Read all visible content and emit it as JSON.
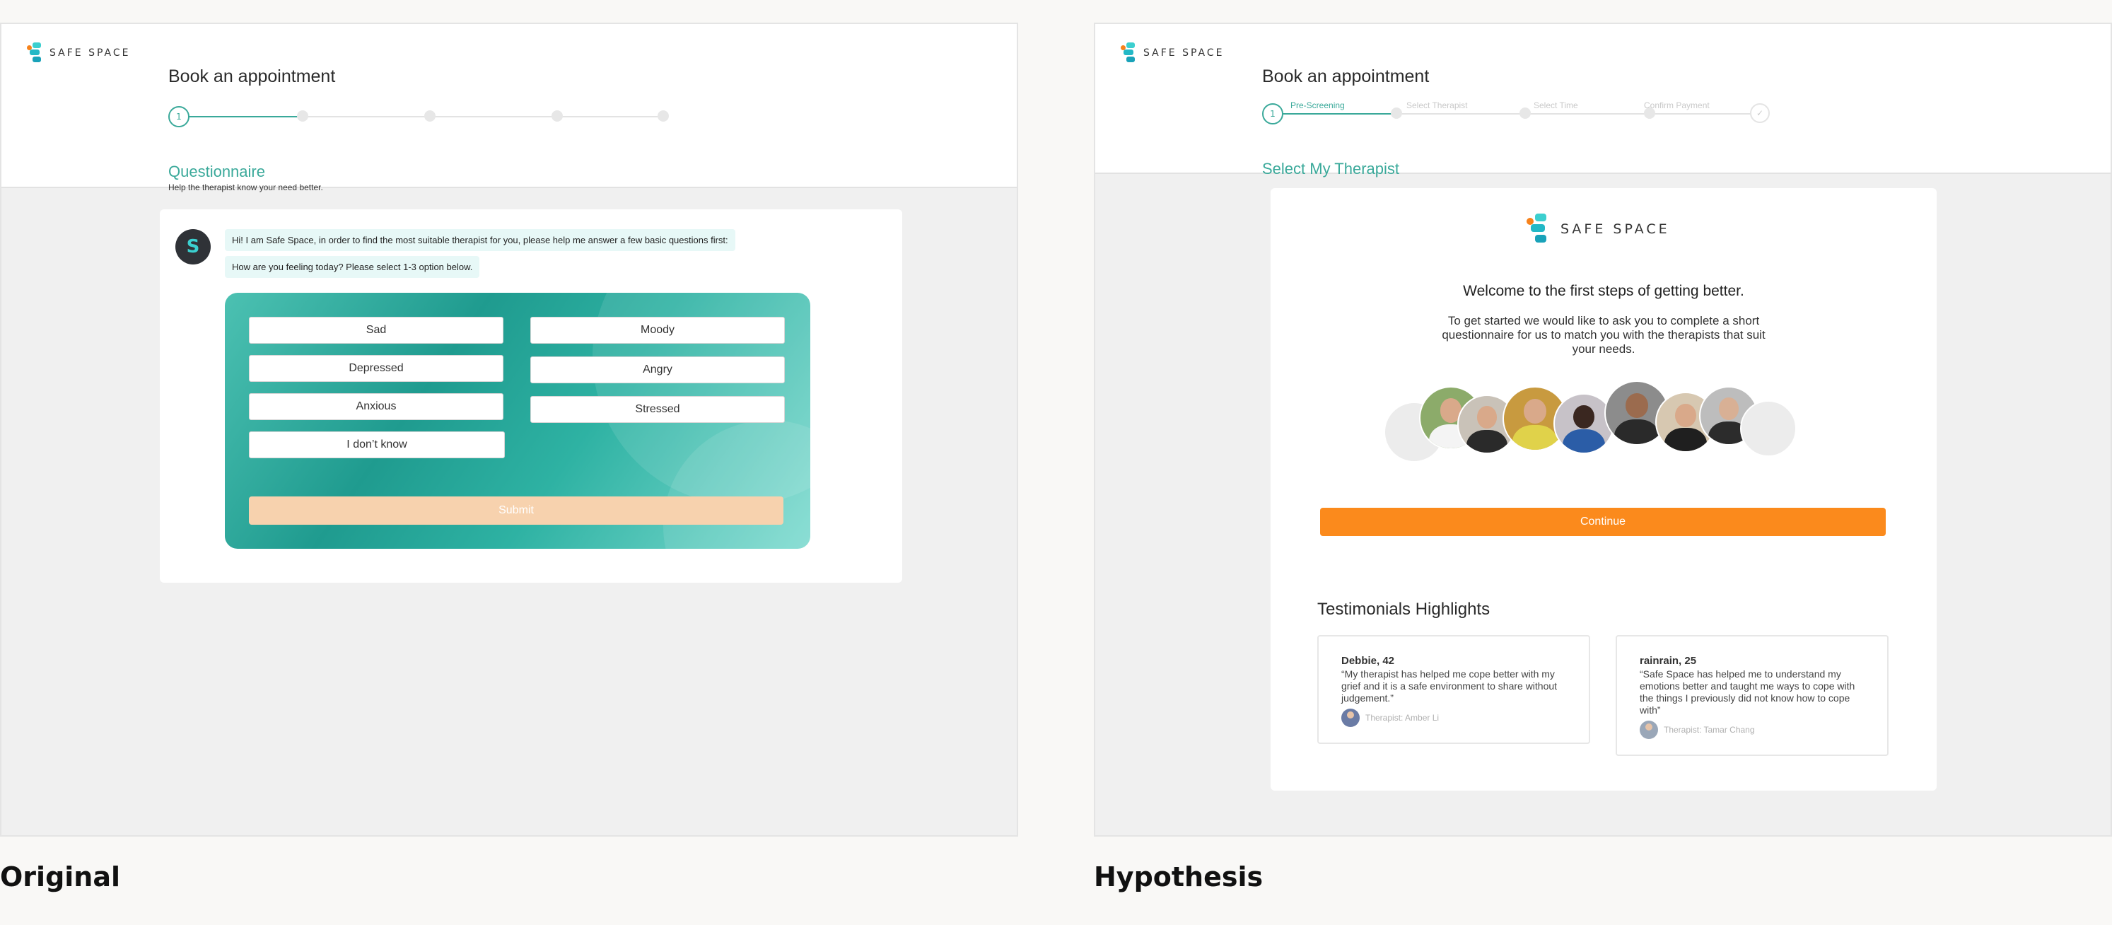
{
  "left": {
    "caption": "Original",
    "logo_text": "SAFE SPACE",
    "title": "Book an appointment",
    "current_step": "1",
    "section_title": "Questionnaire",
    "section_sub": "Help the therapist know your need better.",
    "bot_initial": "S",
    "messages": [
      "Hi! I am Safe Space, in order to find the most suitable therapist for you, please help me answer a few basic questions first:",
      "How are you feeling today? Please select 1-3 option below."
    ],
    "options": [
      "Sad",
      "Moody",
      "Depressed",
      "Angry",
      "Anxious",
      "Stressed",
      "I don’t know"
    ],
    "submit_label": "Submit"
  },
  "right": {
    "caption": "Hypothesis",
    "logo_text": "SAFE SPACE",
    "title": "Book an appointment",
    "current_step": "1",
    "step_labels": [
      "Pre-Screening",
      "Select Therapist",
      "Select Time",
      "Confirm Payment"
    ],
    "done_mark": "✓",
    "section_title": "Select My Therapist",
    "welcome": "Welcome to the first steps of getting better.",
    "intro": "To get started we would like to ask you to complete a short questionnaire for us to match you with the therapists that suit your needs.",
    "continue_label": "Continue",
    "testimonials_title": "Testimonials Highlights",
    "testimonials": [
      {
        "name": "Debbie, 42",
        "quote": "“My therapist has helped me cope better with my grief and it is a safe environment to share without judgement.”",
        "therapist": "Therapist: Amber Li"
      },
      {
        "name": "rainrain, 25",
        "quote": "“Safe Space has helped me to understand my emotions better and taught me ways to cope with the things I previously did not know how to cope with”",
        "therapist": "Therapist: Tamar Chang"
      }
    ]
  },
  "colors": {
    "accent": "#3aa99a",
    "cta": "#fb8a1c",
    "submit_disabled": "#f7d2ae"
  }
}
